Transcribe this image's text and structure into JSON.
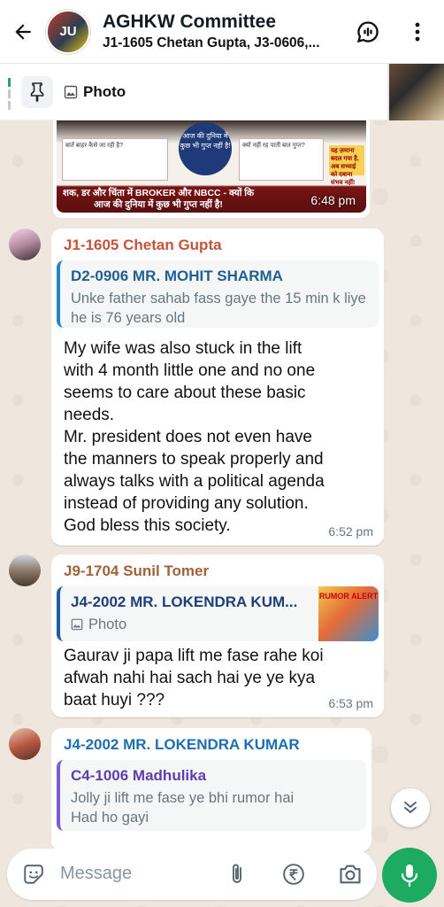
{
  "header": {
    "avatar_text": "JU",
    "title": "AGHKW Committee",
    "subtitle": "J1-1605 Chetan Gupta, J3-0606,..."
  },
  "pinned": {
    "label": "Photo"
  },
  "image_message": {
    "circle_text": "आज की दुनिया में कुछ भी गुप्त नहीं है!",
    "left_box": "बातें बाहर कैसे जा रही है?",
    "right_box": "क्यों नहीं रह पाती बात गुप्त?",
    "yellow_box": "यह ज़माना बदल गया है, अब सच्चाई को दबाना संभव नहीं!",
    "caption": "शक, डर और चिंता में BROKER और NBCC - क्यों कि आज की दुनिया में कुछ भी गुप्त नहीं है!",
    "time": "6:48 pm"
  },
  "messages": [
    {
      "sender": "J1-1605 Chetan Gupta",
      "quote_name": "D2-0906 MR. MOHIT SHARMA",
      "quote_text": "Unke father sahab  fass gaye the 15 min k liye he is 76 years old",
      "text_lines": [
        "My wife was also stuck in the lift",
        "with 4 month little one and no one",
        "seems to care about these basic",
        "needs.",
        "Mr. president does not even have",
        "the manners to speak properly and",
        "always talks with a political agenda",
        "instead of providing any solution.",
        "God bless this society."
      ],
      "time": "6:52 pm"
    },
    {
      "sender": "J9-1704 Sunil Tomer",
      "quote_name": "J4-2002 MR. LOKENDRA KUM...",
      "quote_text": "Photo",
      "quote_thumb_text": "RUMOR ALERT",
      "text_lines": [
        "Gaurav ji papa lift me fase rahe koi",
        "afwah nahi hai sach hai ye ye kya",
        "baat huyi ???"
      ],
      "time": "6:53 pm"
    },
    {
      "sender": "J4-2002 MR. LOKENDRA KUMAR",
      "quote_name": "C4-1006 Madhulika",
      "quote_text_lines": [
        "Jolly ji lift me fase ye bhi rumor hai",
        "Had ho gayi"
      ]
    }
  ],
  "composer": {
    "placeholder": "Message"
  },
  "colors": {
    "sender_1": "#c1543a",
    "sender_2": "#a0623a",
    "sender_3": "#1d6fb0",
    "quote_border_1": "#1d86c9",
    "quote_border_2": "#1e5aa8",
    "quote_border_3": "#7b5bd6",
    "mic_bg": "#1daa61"
  }
}
